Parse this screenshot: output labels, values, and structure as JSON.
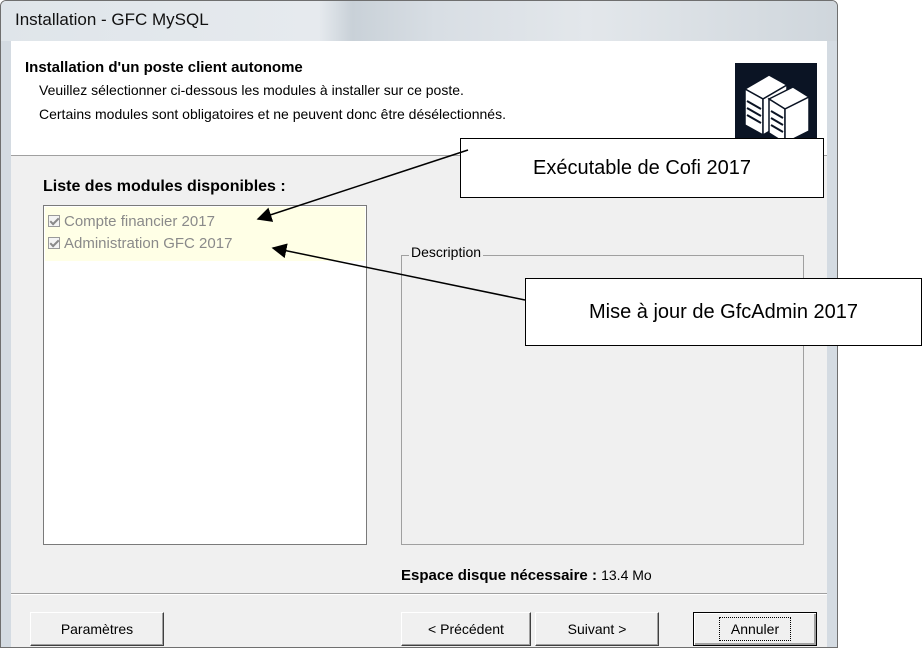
{
  "window": {
    "title": "Installation - GFC MySQL"
  },
  "header": {
    "title": "Installation d'un poste client autonome",
    "line1": "Veuillez sélectionner ci-dessous les modules à installer sur ce poste.",
    "line2": "Certains modules sont obligatoires et ne peuvent donc être désélectionnés."
  },
  "modules": {
    "label": "Liste des modules disponibles :",
    "items": [
      {
        "label": "Compte financier 2017",
        "checked": true,
        "disabled": true
      },
      {
        "label": "Administration GFC 2017",
        "checked": true,
        "disabled": true
      }
    ]
  },
  "description": {
    "label": "Description"
  },
  "disk_space": {
    "label": "Espace disque nécessaire :",
    "value": "13.4 Mo"
  },
  "buttons": {
    "parametres": "Paramètres",
    "precedent": "< Précédent",
    "suivant": "Suivant >",
    "annuler": "Annuler"
  },
  "callouts": {
    "cofi": "Exécutable de Cofi 2017",
    "gfcadmin": "Mise à jour de GfcAdmin 2017"
  },
  "colors": {
    "window_bg": "#f0f0f0",
    "list_highlight": "#ffffe6",
    "disabled_text": "#8a8a8a"
  }
}
